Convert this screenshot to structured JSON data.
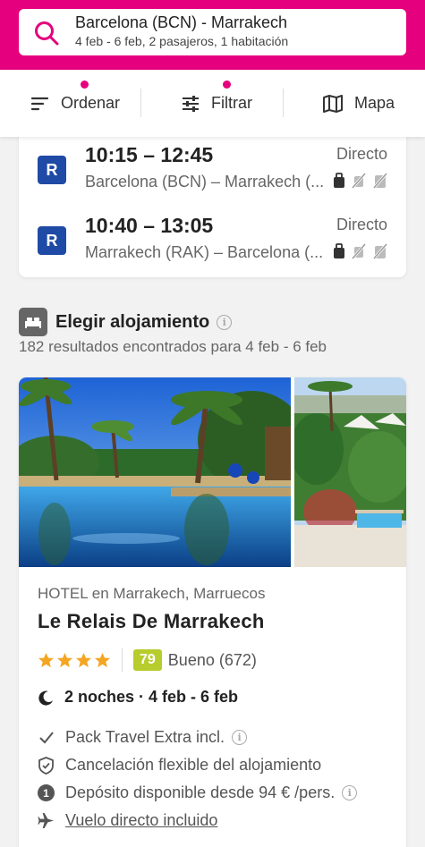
{
  "search": {
    "route": "Barcelona (BCN) - Marrakech",
    "details": "4 feb - 6 feb, 2 pasajeros, 1 habitación",
    "icon": "search-icon",
    "accent_color": "#e5007d"
  },
  "filterbar": {
    "sort_label": "Ordenar",
    "filter_label": "Filtrar",
    "map_label": "Mapa"
  },
  "flights": [
    {
      "airline_code": "R",
      "time": "10:15 – 12:45",
      "route": "Barcelona (BCN) – Marrakech (...",
      "type": "Directo"
    },
    {
      "airline_code": "R",
      "time": "10:40 – 13:05",
      "route": "Marrakech (RAK) – Barcelona (...",
      "type": "Directo"
    }
  ],
  "accommodation": {
    "title": "Elegir alojamiento",
    "results": "182 resultados encontrados para 4 feb - 6 feb"
  },
  "hotel": {
    "type_location": "HOTEL en Marrakech, Marruecos",
    "name": "Le Relais De Marrakech",
    "stars": 4,
    "score": "79",
    "score_label": "Bueno (672)",
    "nights": "2 noches · 4 feb - 6 feb",
    "features": {
      "pack": "Pack Travel Extra incl.",
      "cancellation": "Cancelación flexible del alojamiento",
      "deposit": "Depósito disponible desde 94 € /pers.",
      "deposit_badge": "1",
      "flight": "Vuelo directo incluido"
    }
  }
}
